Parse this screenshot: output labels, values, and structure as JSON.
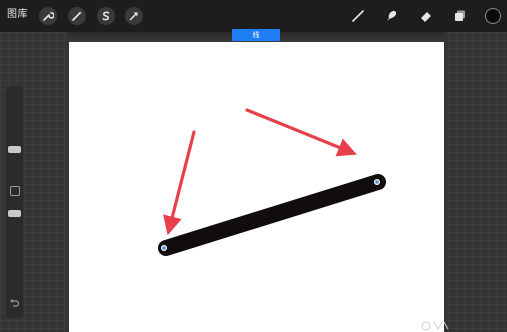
{
  "toolbar": {
    "gallery_label": "图库",
    "left_tools": [
      {
        "icon": "wrench-icon"
      },
      {
        "icon": "magic-wand-icon"
      },
      {
        "icon": "selection-s-icon"
      },
      {
        "icon": "transform-arrow-icon"
      }
    ],
    "right_tools": [
      {
        "icon": "brush-icon"
      },
      {
        "icon": "smudge-icon"
      },
      {
        "icon": "eraser-icon"
      },
      {
        "icon": "layers-icon"
      }
    ],
    "color": "#0e0b0b"
  },
  "quickshape": {
    "label": "线"
  },
  "colors": {
    "accent": "#1f7ef5",
    "stroke": "#120d0d",
    "annotation_arrow": "#e8404a",
    "node": "#4a90e2"
  }
}
